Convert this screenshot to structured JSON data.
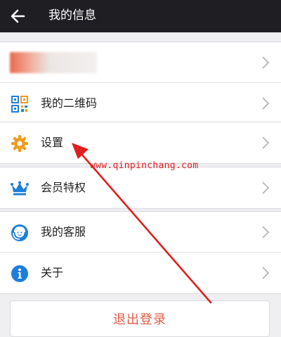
{
  "header": {
    "title": "我的信息"
  },
  "rows": {
    "qrcode": "我的二维码",
    "settings": "设置",
    "vip": "会员特权",
    "service": "我的客服",
    "about": "关于"
  },
  "watermark": "www.qinpinchang.com",
  "logout": {
    "label": "退出登录"
  },
  "colors": {
    "header_bg": "#1f1f23",
    "page_bg": "#efeff2",
    "icon_blue": "#1d7fd9",
    "icon_orange": "#f39a1e",
    "logout_text": "#e05b43",
    "annotation_red": "#e02020"
  },
  "icons": {
    "back": "arrow-left-icon",
    "qrcode": "qr-code-icon",
    "settings": "gear-icon",
    "vip": "crown-icon",
    "service": "customer-service-icon",
    "about": "info-icon",
    "chevron": "chevron-right-icon"
  }
}
